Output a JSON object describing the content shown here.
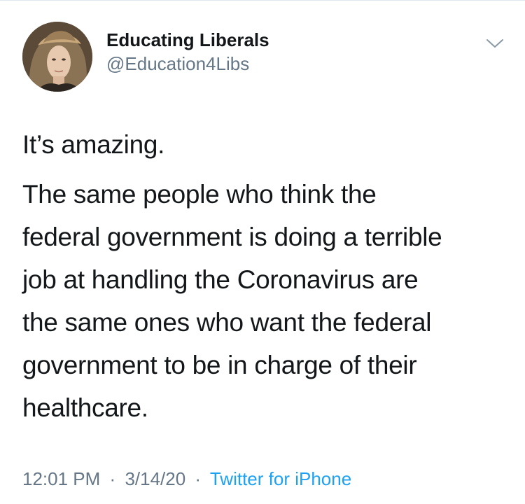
{
  "tweet": {
    "display_name": "Educating Liberals",
    "handle": "@Education4Libs",
    "text_intro": "It’s amazing.",
    "text_lines": [
      "The same people who think the",
      "federal government is doing a terrible",
      "job at handling the Coronavirus are",
      "the same ones who want the federal",
      "government to be in charge of their",
      "healthcare."
    ],
    "time": "12:01 PM",
    "date": "3/14/20",
    "separator": "·",
    "source": "Twitter for iPhone"
  },
  "icons": {
    "more": "chevron-down-icon",
    "avatar": "profile-photo"
  },
  "colors": {
    "text": "#14171a",
    "secondary": "#657786",
    "link": "#1da1f2"
  }
}
